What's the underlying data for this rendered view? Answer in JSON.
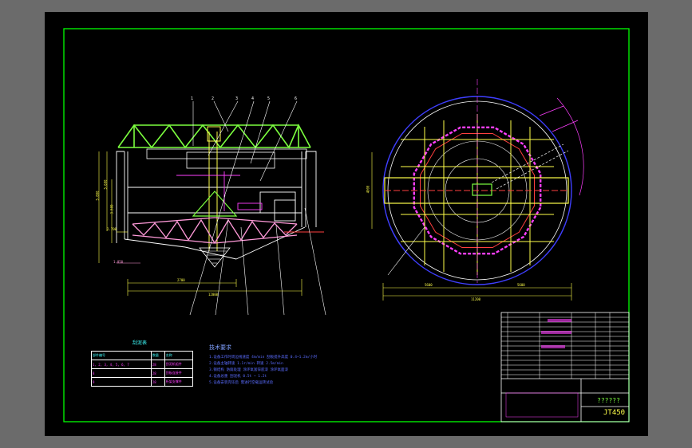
{
  "drawing": {
    "drawing_number": "JT450",
    "title_text": "??????",
    "section_view_title": "",
    "plan_view_title": ""
  },
  "tech_notes": {
    "heading": "技术要求",
    "lines": [
      "1.设备工作时周边线速度 4m/min 刮板提升高度 0.4~1.2m/小时",
      "2.设备主轴转速 1.1r/min 转速 2.5m/min",
      "3.钢结构 防腐处理 涂环氧富锌底漆 涂环氧面漆",
      "4.设备总重 刮泥机 0.5t ~ 1.2t",
      "5.设备安装完毕后 需进行空载运转试验"
    ]
  },
  "legend_table": {
    "caption": "刮泥表",
    "headers": [
      "部件编号",
      "数量",
      "名称"
    ],
    "rows": [
      [
        "1, 2, 3, 4, 5, 6, 7",
        "28",
        "刮泥机组件"
      ],
      [
        "8",
        "28",
        "刮板连接件"
      ],
      [
        "9",
        "28",
        "桁架支撑件"
      ]
    ]
  },
  "dimensions": {
    "left": [
      "5.800",
      "5.600",
      "3.500",
      "2.700",
      "1.050"
    ],
    "bottom": [
      "2700",
      "12000"
    ],
    "plan_bottom": [
      "5600",
      "5600",
      "11200"
    ],
    "plan_left": [
      "4000"
    ]
  },
  "colors": {
    "frame": "#00ff00",
    "truss": "#7cff3f",
    "lines": "#ffffff",
    "magenta": "#ff3fff",
    "yellow": "#ffff4a",
    "blue": "#3f3fff",
    "red": "#ff3f3f",
    "cyan": "#3fffff"
  }
}
